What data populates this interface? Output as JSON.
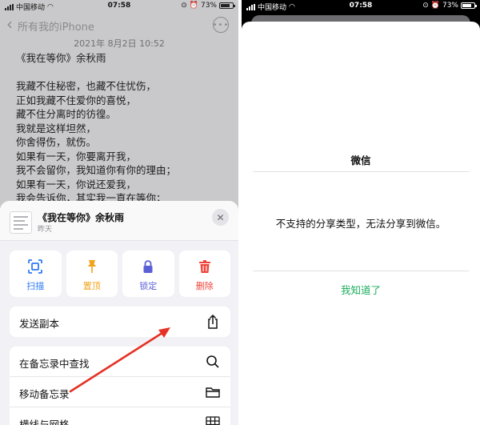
{
  "left": {
    "status": {
      "carrier": "中国移动",
      "time": "07:58",
      "battery": "73%"
    },
    "nav": {
      "back_label": "所有我的iPhone",
      "more_label": "•••"
    },
    "note": {
      "date": "2021年 8月2日 10:52",
      "lines": [
        "《我在等你》余秋雨",
        "",
        "我藏不住秘密，也藏不住忧伤，",
        "正如我藏不住爱你的喜悦，",
        "藏不住分离时的彷徨。",
        "我就是这样坦然，",
        "你舍得伤，就伤。",
        "如果有一天，你要离开我，",
        "我不会留你，我知道你有你的理由；",
        "如果有一天，你说还爱我，",
        "我会告诉你，其实我一直在等你；"
      ]
    },
    "sheet": {
      "title": "《我在等你》余秋雨",
      "subtitle": "昨天",
      "close_label": "✕",
      "actions": [
        {
          "label": "扫描",
          "icon": "scan-icon",
          "color": "#2f7bf5"
        },
        {
          "label": "置顶",
          "icon": "pin-icon",
          "color": "#f2a31b"
        },
        {
          "label": "锁定",
          "icon": "lock-icon",
          "color": "#5b5fd6"
        },
        {
          "label": "删除",
          "icon": "trash-icon",
          "color": "#f0443a"
        }
      ],
      "send_copy": "发送副本",
      "rows": [
        "在备忘录中查找",
        "移动备忘录",
        "横线与网格"
      ]
    }
  },
  "right": {
    "status": {
      "carrier": "中国移动",
      "time": "07:58",
      "battery": "73%"
    },
    "dialog": {
      "title": "微信",
      "message": "不支持的分享类型，无法分享到微信。",
      "ok": "我知道了"
    }
  },
  "colors": {
    "annotation_arrow": "#e53224",
    "wechat_green": "#1aad5b"
  }
}
